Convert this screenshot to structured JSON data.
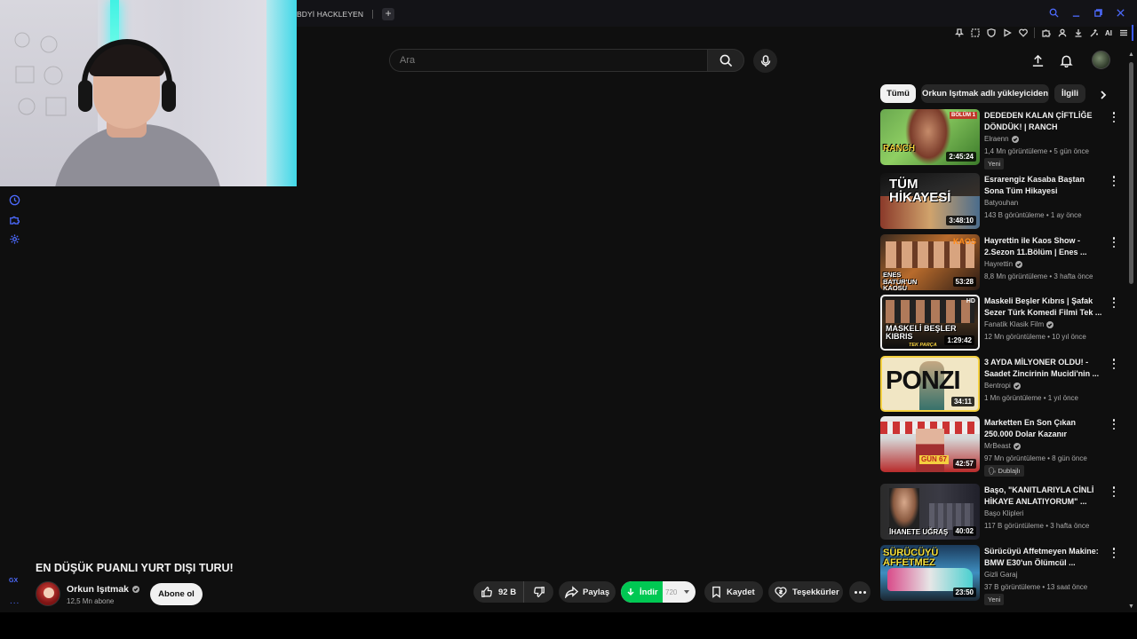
{
  "browser": {
    "tab_title": "BDYİ HACKLEYEN",
    "new_tab": "+",
    "ai_label": "AI"
  },
  "search": {
    "placeholder": "Ara"
  },
  "chips": [
    "Tümü",
    "Orkun Işıtmak adlı yükleyiciden",
    "İlgili"
  ],
  "recommendations": [
    {
      "title": "DEDEDEN KALAN ÇİFTLİĞE DÖNDÜK! | RANCH SIMULATO...",
      "channel": "Elraenn",
      "verified": true,
      "meta": "1,4 Mn görüntüleme • 5 gün önce",
      "badge": "Yeni",
      "duration": "2:45:24",
      "thumb_text": "RANCH",
      "thumb_tag": "BÖLÜM 1"
    },
    {
      "title": "Esrarengiz Kasaba Baştan Sona Tüm Hikayesi",
      "channel": "Batyouhan",
      "verified": false,
      "meta": "143 B görüntüleme • 1 ay önce",
      "duration": "3:48:10",
      "thumb_text": "TÜM HİKAYESİ"
    },
    {
      "title": "Hayrettin ile Kaos Show - 2.Sezon 11.Bölüm | Enes ...",
      "channel": "Hayrettin",
      "verified": true,
      "meta": "8,8 Mn görüntüleme • 3 hafta önce",
      "duration": "53:28",
      "thumb_text": "ENES BATUR'UN KAOSU",
      "thumb_tag": "KAOS"
    },
    {
      "title": "Maskeli Beşler Kıbrıs | Şafak Sezer Türk Komedi Filmi Tek ...",
      "channel": "Fanatik Klasik Film",
      "verified": true,
      "meta": "12 Mn görüntüleme • 10 yıl önce",
      "duration": "1:29:42",
      "thumb_text": "MASKELİ BEŞLER KIBRIS",
      "thumb_tag": "TEK PARÇA",
      "thumb_hd": "HD"
    },
    {
      "title": "3 AYDA MİLYONER OLDU! - Saadet Zincirinin Mucidi'nin ...",
      "channel": "Bentropi",
      "verified": true,
      "meta": "1 Mn görüntüleme • 1 yıl önce",
      "duration": "34:11",
      "thumb_text": "PONZI"
    },
    {
      "title": "Marketten En Son Çıkan 250.000 Dolar Kazanır",
      "channel": "MrBeast",
      "verified": true,
      "meta": "97 Mn görüntüleme • 8 gün önce",
      "badge": "Dublajlı",
      "duration": "42:57",
      "thumb_text": "GÜN 67"
    },
    {
      "title": "Başo, \"KANITLARIYLA CİNLİ HİKAYE ANLATIYORUM\" ...",
      "channel": "Başo Klipleri",
      "verified": false,
      "meta": "117 B görüntüleme • 3 hafta önce",
      "duration": "40:02",
      "thumb_text": "İHANETE UĞRAŞ"
    },
    {
      "title": "Sürücüyü Affetmeyen Makine: BMW E30'un Ölümcül ...",
      "channel": "Gizli Garaj",
      "verified": false,
      "meta": "37 B görüntüleme • 13 saat önce",
      "badge": "Yeni",
      "duration": "23:50",
      "thumb_text": "SÜRÜCÜYÜ AFFETMEZ"
    }
  ],
  "video": {
    "title": "EN DÜŞÜK PUANLI YURT DIŞI TURU!",
    "channel_name": "Orkun Işıtmak",
    "subscribers": "12,5 Mn abone",
    "subscribe_label": "Abone ol",
    "likes": "92 B",
    "share_label": "Paylaş",
    "download_label": "İndir",
    "download_quality": "720",
    "save_label": "Kaydet",
    "thanks_label": "Teşekkürler"
  },
  "sidebar_mini": {
    "gx_label": "GX",
    "more_label": "..."
  },
  "colors": {
    "background": "#0f0f0f",
    "accent_blue": "#4d6bff",
    "download_green": "#00c853",
    "chip_active": "#f1f1f1"
  }
}
